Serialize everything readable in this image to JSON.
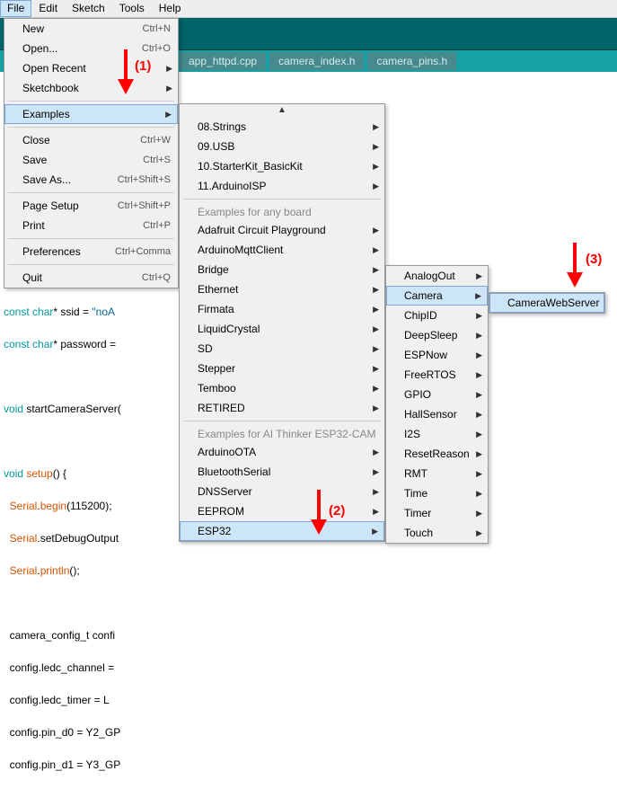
{
  "menubar": [
    "File",
    "Edit",
    "Sketch",
    "Tools",
    "Help"
  ],
  "fileMenu": [
    {
      "label": "New",
      "shortcut": "Ctrl+N"
    },
    {
      "label": "Open...",
      "shortcut": "Ctrl+O"
    },
    {
      "label": "Open Recent",
      "sub": true
    },
    {
      "label": "Sketchbook",
      "sub": true
    },
    {
      "sep": true
    },
    {
      "label": "Examples",
      "sub": true,
      "hover": true
    },
    {
      "sep": true
    },
    {
      "label": "Close",
      "shortcut": "Ctrl+W"
    },
    {
      "label": "Save",
      "shortcut": "Ctrl+S"
    },
    {
      "label": "Save As...",
      "shortcut": "Ctrl+Shift+S"
    },
    {
      "sep": true
    },
    {
      "label": "Page Setup",
      "shortcut": "Ctrl+Shift+P"
    },
    {
      "label": "Print",
      "shortcut": "Ctrl+P"
    },
    {
      "sep": true
    },
    {
      "label": "Preferences",
      "shortcut": "Ctrl+Comma"
    },
    {
      "sep": true
    },
    {
      "label": "Quit",
      "shortcut": "Ctrl+Q"
    }
  ],
  "examplesMenu": {
    "scrollUpGlyph": "▲",
    "top": [
      {
        "label": "08.Strings",
        "sub": true
      },
      {
        "label": "09.USB",
        "sub": true
      },
      {
        "label": "10.StarterKit_BasicKit",
        "sub": true
      },
      {
        "label": "11.ArduinoISP",
        "sub": true
      }
    ],
    "header1": "Examples for any board",
    "group1": [
      {
        "label": "Adafruit Circuit Playground",
        "sub": true
      },
      {
        "label": "ArduinoMqttClient",
        "sub": true
      },
      {
        "label": "Bridge",
        "sub": true
      },
      {
        "label": "Ethernet",
        "sub": true
      },
      {
        "label": "Firmata",
        "sub": true
      },
      {
        "label": "LiquidCrystal",
        "sub": true
      },
      {
        "label": "SD",
        "sub": true
      },
      {
        "label": "Stepper",
        "sub": true
      },
      {
        "label": "Temboo",
        "sub": true
      },
      {
        "label": "RETIRED",
        "sub": true
      }
    ],
    "header2": "Examples for AI Thinker ESP32-CAM",
    "group2": [
      {
        "label": "ArduinoOTA",
        "sub": true
      },
      {
        "label": "BluetoothSerial",
        "sub": true
      },
      {
        "label": "DNSServer",
        "sub": true
      },
      {
        "label": "EEPROM",
        "sub": true
      },
      {
        "label": "ESP32",
        "sub": true,
        "hover": true
      }
    ]
  },
  "esp32Menu": [
    {
      "label": "AnalogOut",
      "sub": true
    },
    {
      "label": "Camera",
      "sub": true,
      "hover": true
    },
    {
      "label": "ChipID",
      "sub": true
    },
    {
      "label": "DeepSleep",
      "sub": true
    },
    {
      "label": "ESPNow",
      "sub": true
    },
    {
      "label": "FreeRTOS",
      "sub": true
    },
    {
      "label": "GPIO",
      "sub": true
    },
    {
      "label": "HallSensor",
      "sub": true
    },
    {
      "label": "I2S",
      "sub": true
    },
    {
      "label": "ResetReason",
      "sub": true
    },
    {
      "label": "RMT",
      "sub": true
    },
    {
      "label": "Time",
      "sub": true
    },
    {
      "label": "Timer",
      "sub": true
    },
    {
      "label": "Touch",
      "sub": true
    }
  ],
  "cameraMenu": [
    {
      "label": "CameraWebServer",
      "hover": true
    }
  ],
  "tabs": [
    "app_httpd.cpp",
    "camera_index.h",
    "camera_pins.h"
  ],
  "annotations": {
    "a1": "(1)",
    "a2": "(2)",
    "a3": "(3)"
  },
  "code": {
    "l1a": "const char",
    "l1b": "* ssid = ",
    "l1c": "\"noA",
    "l2a": "const char",
    "l2b": "* password = ",
    "l3a": "void",
    "l3b": " startCameraServer(",
    "l4a": "void",
    "l4b": " ",
    "l4c": "setup",
    "l4d": "() {",
    "l5a": "  ",
    "l5b": "Serial",
    "l5c": ".",
    "l5d": "begin",
    "l5e": "(115200);",
    "l6a": "  ",
    "l6b": "Serial",
    "l6c": ".setDebugOutput",
    "l7a": "  ",
    "l7b": "Serial",
    "l7c": ".",
    "l7d": "println",
    "l7e": "();",
    "l8": "  camera_config_t confi",
    "l9": "  config.ledc_channel =",
    "l10": "  config.ledc_timer = L",
    "l11": "  config.pin_d0 = Y2_GP",
    "l12": "  config.pin_d1 = Y3_GP"
  }
}
